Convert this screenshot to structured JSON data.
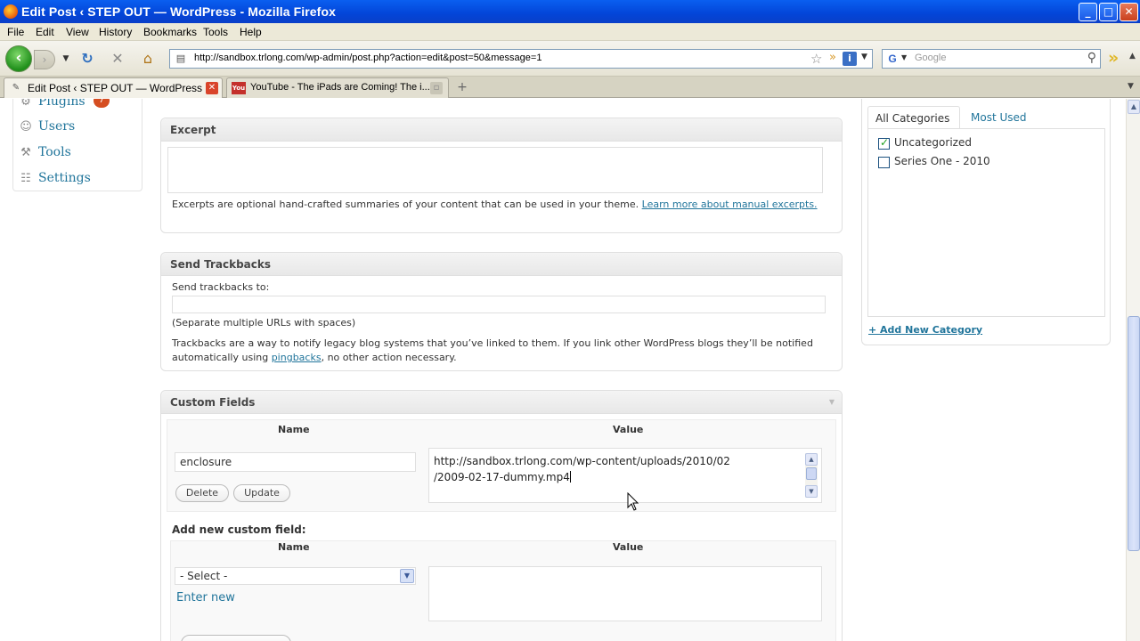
{
  "window": {
    "title": "Edit Post ‹ STEP OUT — WordPress - Mozilla Firefox",
    "buttons": {
      "minimize": "_",
      "maximize": "□",
      "close": "✕"
    }
  },
  "menubar": [
    "File",
    "Edit",
    "View",
    "History",
    "Bookmarks",
    "Tools",
    "Help"
  ],
  "navbar": {
    "url": "http://sandbox.trlong.com/wp-admin/post.php?action=edit&post=50&message=1",
    "search_placeholder": "Google"
  },
  "tabs": [
    {
      "label": "Edit Post ‹ STEP OUT — WordPress",
      "active": true
    },
    {
      "label": "YouTube - The iPads are Coming! The i...",
      "active": false
    }
  ],
  "admin_menu": [
    {
      "label": "Plugins",
      "icon": "plugin-icon",
      "badge": "7"
    },
    {
      "label": "Users",
      "icon": "users-icon"
    },
    {
      "label": "Tools",
      "icon": "tools-icon"
    },
    {
      "label": "Settings",
      "icon": "settings-icon"
    }
  ],
  "excerpt": {
    "title": "Excerpt",
    "value": "",
    "help": "Excerpts are optional hand-crafted summaries of your content that can be used in your theme.",
    "link": "Learn more about manual excerpts."
  },
  "trackbacks": {
    "title": "Send Trackbacks",
    "label": "Send trackbacks to:",
    "value": "",
    "hint": "(Separate multiple URLs with spaces)",
    "help_before": "Trackbacks are a way to notify legacy blog systems that you’ve linked to them. If you link other WordPress blogs they’ll be notified automatically using",
    "help_link": "pingbacks",
    "help_after": ", no other action necessary."
  },
  "custom_fields": {
    "title": "Custom Fields",
    "col_name": "Name",
    "col_value": "Value",
    "field_name": "enclosure",
    "field_value_line1": "http://sandbox.trlong.com/wp-content/uploads/2010/02",
    "field_value_line2": "/2009-02-17-dummy.mp4",
    "delete_label": "Delete",
    "update_label": "Update",
    "add_new_label": "Add new custom field:",
    "select_value": "- Select -",
    "enter_new": "Enter new",
    "new_value": ""
  },
  "categories": {
    "tab_all": "All Categories",
    "tab_most_used": "Most Used",
    "items": [
      {
        "label": "Uncategorized",
        "checked": true
      },
      {
        "label": "Series One - 2010",
        "checked": false
      }
    ],
    "add_new": "+ Add New Category"
  },
  "colors": {
    "link": "#21759b",
    "badge": "#d54e21",
    "titlebar": "#0345d8"
  }
}
